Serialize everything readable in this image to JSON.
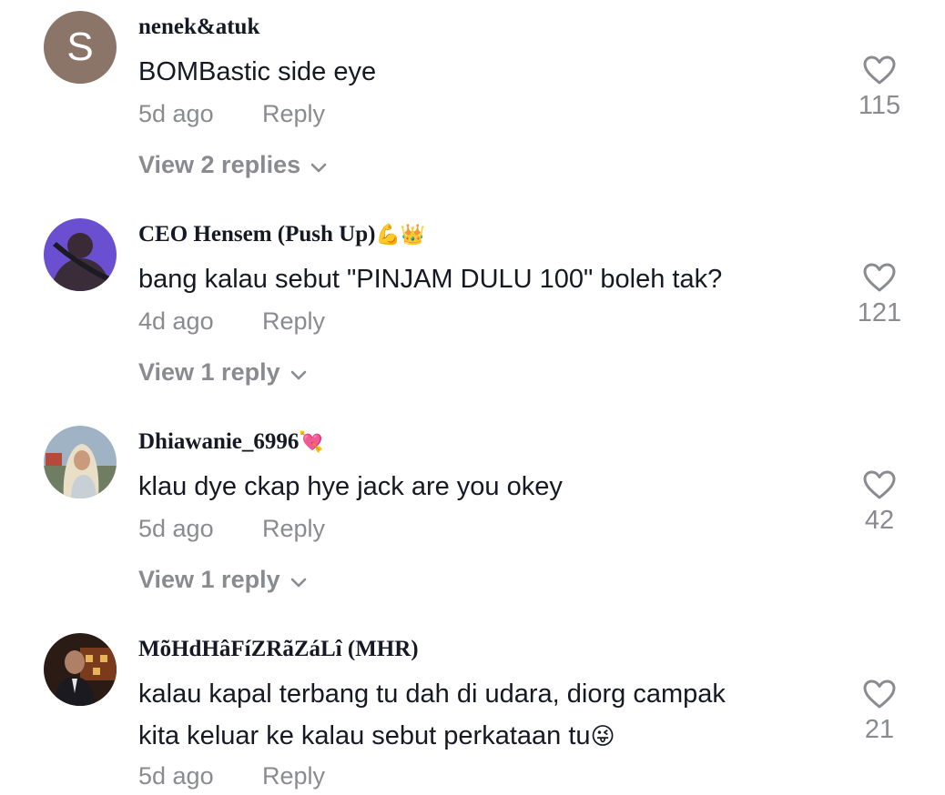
{
  "comments": [
    {
      "username": "nenek&atuk",
      "username_emoji": "",
      "avatar_letter": "S",
      "text": "BOMBastic side eye",
      "time": "5d ago",
      "reply_label": "Reply",
      "likes": "115",
      "view_replies": "View 2 replies"
    },
    {
      "username": "CEO Hensem (Push Up)",
      "username_emoji": "💪👑",
      "text": "bang kalau sebut \"PINJAM DULU 100\" boleh tak?",
      "time": "4d ago",
      "reply_label": "Reply",
      "likes": "121",
      "view_replies": "View 1 reply"
    },
    {
      "username": "Dhiawanie_6996",
      "username_emoji": "💘",
      "text": "klau dye ckap hye jack are you okey",
      "time": "5d ago",
      "reply_label": "Reply",
      "likes": "42",
      "view_replies": "View 1 reply"
    },
    {
      "username": "MõHdHâFíZRãZáLî (MHR)",
      "username_emoji": "",
      "text_line1": "kalau kapal terbang tu dah di udara, diorg campak",
      "text_line2": "kita keluar ke kalau sebut perkataan tu",
      "text_emoji": "😜",
      "time": "5d ago",
      "reply_label": "Reply",
      "likes": "21"
    }
  ],
  "colors": {
    "primary_text": "#161823",
    "secondary_text": "#8a8b91",
    "avatar_letter_bg": "#8a7568"
  },
  "icons": {
    "like": "heart-outline-icon",
    "expand": "chevron-down-icon"
  }
}
